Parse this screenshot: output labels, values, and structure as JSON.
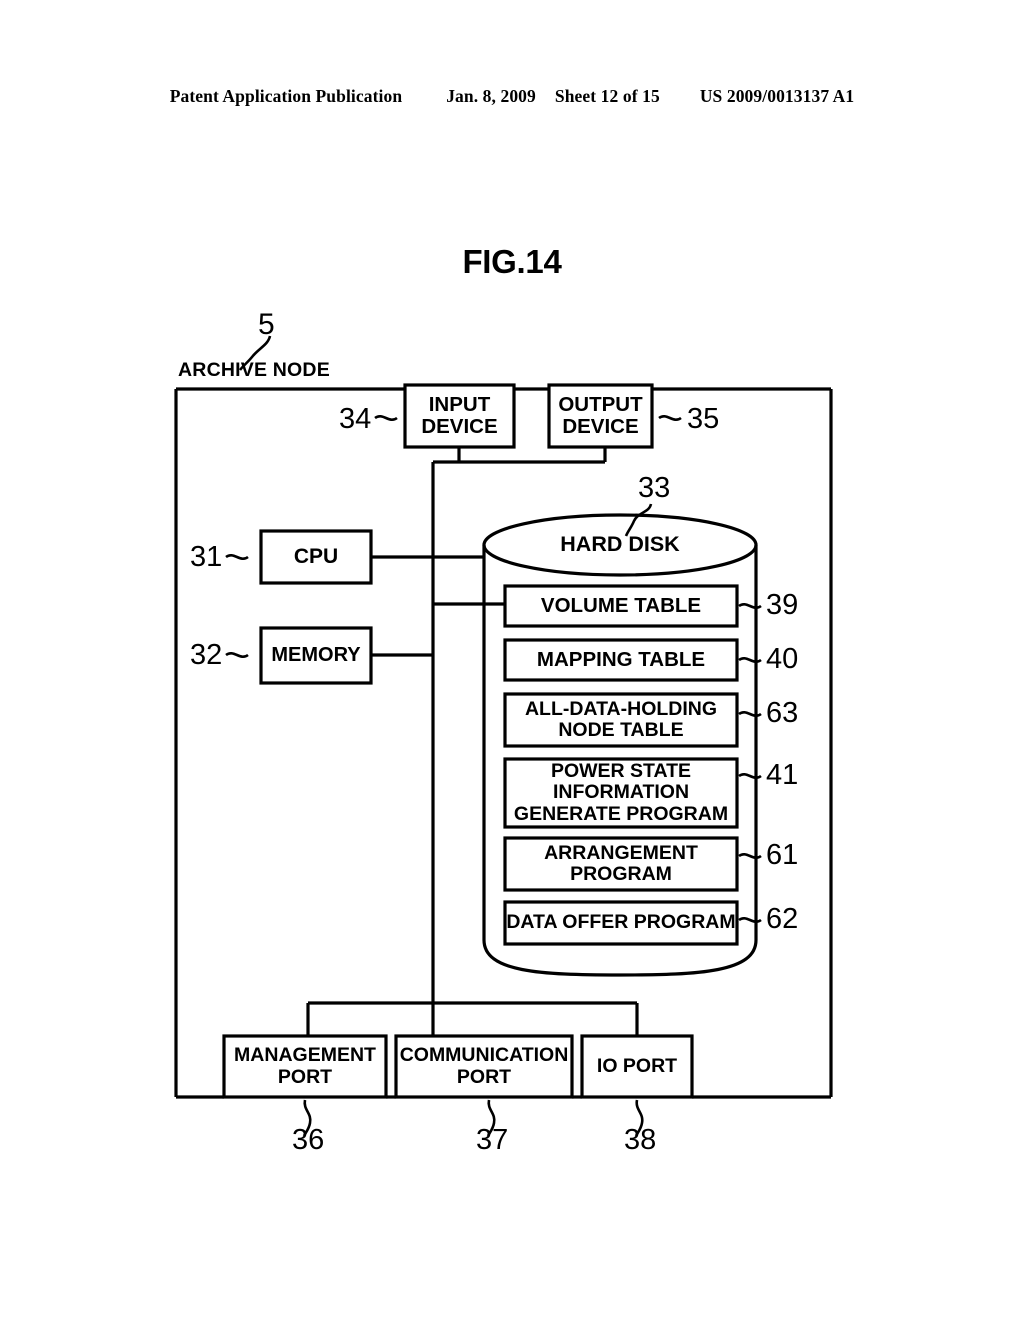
{
  "header": {
    "publication": "Patent Application Publication",
    "date": "Jan. 8, 2009",
    "sheet": "Sheet 12 of 15",
    "patent_number": "US 2009/0013137 A1"
  },
  "figure": {
    "title": "FIG.14",
    "outer_label": "ARCHIVE NODE",
    "outer_ref": "5",
    "nodes": [
      {
        "id": "input-device",
        "label": "INPUT\nDEVICE",
        "ref": "34"
      },
      {
        "id": "output-device",
        "label": "OUTPUT\nDEVICE",
        "ref": "35"
      },
      {
        "id": "cpu",
        "label": "CPU",
        "ref": "31"
      },
      {
        "id": "memory",
        "label": "MEMORY",
        "ref": "32"
      },
      {
        "id": "hard-disk",
        "label": "HARD DISK",
        "ref": "33"
      },
      {
        "id": "volume-table",
        "label": "VOLUME TABLE",
        "ref": "39"
      },
      {
        "id": "mapping-table",
        "label": "MAPPING TABLE",
        "ref": "40"
      },
      {
        "id": "all-data-holding-node-table",
        "label": "ALL-DATA-HOLDING\nNODE TABLE",
        "ref": "63"
      },
      {
        "id": "power-state-information-generate-program",
        "label": "POWER STATE\nINFORMATION\nGENERATE PROGRAM",
        "ref": "41"
      },
      {
        "id": "arrangement-program",
        "label": "ARRANGEMENT\nPROGRAM",
        "ref": "61"
      },
      {
        "id": "data-offer-program",
        "label": "DATA OFFER PROGRAM",
        "ref": "62"
      },
      {
        "id": "management-port",
        "label": "MANAGEMENT\nPORT",
        "ref": "36"
      },
      {
        "id": "communication-port",
        "label": "COMMUNICATION\nPORT",
        "ref": "37"
      },
      {
        "id": "io-port",
        "label": "IO PORT",
        "ref": "38"
      }
    ]
  },
  "chart_data": {
    "type": "diagram",
    "title": "FIG.14",
    "description": "Block diagram of an archive node",
    "blocks": [
      "INPUT DEVICE",
      "OUTPUT DEVICE",
      "CPU",
      "MEMORY",
      "HARD DISK",
      "VOLUME TABLE",
      "MAPPING TABLE",
      "ALL-DATA-HOLDING NODE TABLE",
      "POWER STATE INFORMATION GENERATE PROGRAM",
      "ARRANGEMENT PROGRAM",
      "DATA OFFER PROGRAM",
      "MANAGEMENT PORT",
      "COMMUNICATION PORT",
      "IO PORT"
    ],
    "reference_numerals": [
      "5",
      "31",
      "32",
      "33",
      "34",
      "35",
      "36",
      "37",
      "38",
      "39",
      "40",
      "41",
      "61",
      "62",
      "63"
    ]
  }
}
